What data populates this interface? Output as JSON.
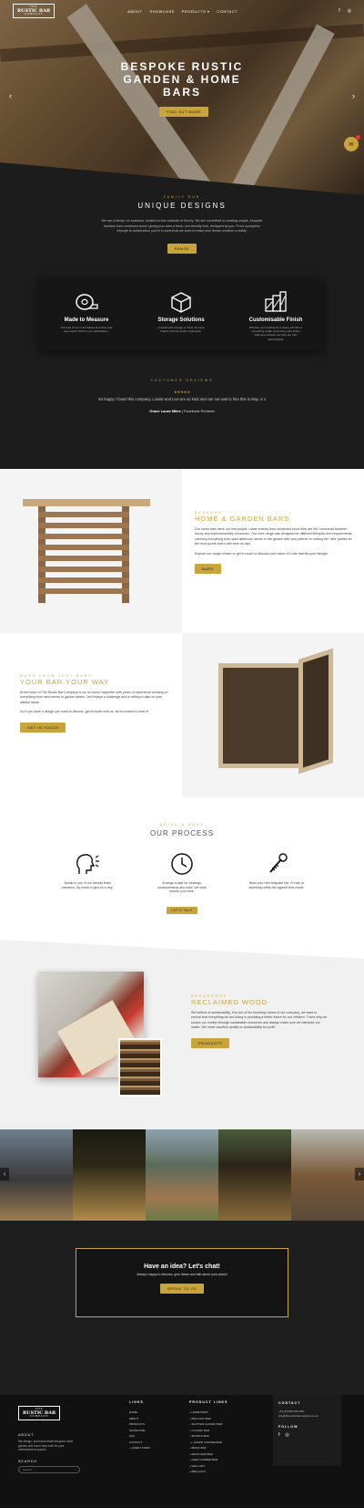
{
  "brand": {
    "logo_top": "THE",
    "logo_main": "RUSTIC BAR",
    "logo_sub": "COMPANY"
  },
  "nav": {
    "items": [
      "ABOUT",
      "SHOWCASE",
      "PRODUCTS ▾",
      "CONTACT"
    ],
    "social": [
      "f",
      "◎"
    ]
  },
  "hero": {
    "title_line1": "BESPOKE RUSTIC",
    "title_line2": "GARDEN & HOME",
    "title_line3": "BARS",
    "button": "FIND OUT MORE"
  },
  "intro": {
    "kicker": "FAMILY RUN",
    "title": "UNIQUE DESIGNS",
    "body": "We are a family run business, located on the outskirts of Surrey. We are committed to creating unique, bespoke furniture from reclaimed wood, giving your area a fresh, eco-friendly look, designed by you. From conception through to construction you're in control as we work to make your dream creation a reality.",
    "button": "RANGE"
  },
  "features": [
    {
      "icon": "tape-measure-icon",
      "title": "Made to Measure",
      "text": "Our bars come in all shapes and sizes and are custom built to your specification."
    },
    {
      "icon": "box-icon",
      "title": "Storage Solutions",
      "text": "Created with storage in mind, we have feature shelves and/or cupboards."
    },
    {
      "icon": "finish-icon",
      "title": "Customisable Finish",
      "text": "Whether your looking for a classy varnish or something a little more fancy with all the bells and whistles our bars are fully customisable."
    }
  ],
  "reviews": {
    "kicker": "CUSTOMER REVIEWS",
    "stars": "★★★★★",
    "quote": "So happy I found this company. Louise and Levi are so kind and can not wait to hire this in May. X x",
    "author": "Grace Laura Miles",
    "source": " | Facebook Reviews"
  },
  "home_bars": {
    "kicker": "BESPOKE",
    "title": "HOME & GARDEN BARS",
    "p1": "Our home bars were our first project, made entirely from reclaimed wood they are the 'crossroad between luxury and environmentally conscious'. Our core range was designed for different lifestyles and requirements, covering everything from quiet afternoon drinks in the garden with your partner to hosting the 'wild' parties for the next sports event with beer on tap!",
    "p2": "Explore our range of bars or get in touch to discuss your vision of a bar that fits your lifestyle.",
    "button": "BARS"
  },
  "your_way": {
    "kicker": "MADE FROM JUST BARS",
    "title": "YOUR BAR YOUR WAY",
    "p1": "At the heart of The Rustic Bar Company is our in-house carpenter with years of experience working on everything from new homes to garden tables. Levi enjoys a challenge and is willing to take on your wildest ideas.",
    "p2": "So if you have a design you want to discuss, get in touch with us, we're excited to hear it!",
    "button": "GET IN TOUCH"
  },
  "process": {
    "kicker": "QUICK & EASY",
    "title": "OUR PROCESS",
    "steps": [
      {
        "icon": "speaking-head-icon",
        "text": "Speak to one of our friendly team members. By email or give us a ring."
      },
      {
        "icon": "clock-icon",
        "text": "Arrange a date for viewings, measurements and build. We work around your time."
      },
      {
        "icon": "screw-icon",
        "text": "Build your new bespoke bar. On site or assembly within the agreed time frame."
      }
    ],
    "button": "LET'S TALK"
  },
  "reclaimed": {
    "kicker": "REPURPOSE",
    "title": "RECLAIMED WOOD",
    "body": "We believe in sustainability, it is one of the founding values of our company, we want to ensure that everything we are doing is providing a better future for our children. That's why we source our lumber through sustainable resources and always make sure we minimise our waste. We never sacrifice quality or sustainability for profit.",
    "button": "PRODUCTS"
  },
  "cta": {
    "title": "Have an idea? Let's chat!",
    "subtitle": "Always happy to discuss, give ideas and talk about your plans!",
    "button": "SPEAK TO US"
  },
  "footer": {
    "about_title": "ABOUT",
    "about_text": "We design, build and install bespoke rustic garden and home bars built for your entertainment spaces.",
    "search_title": "SEARCH",
    "search_placeholder": "Search ...",
    "links_title": "LINKS",
    "links": [
      "HOME",
      "ABOUT",
      "PRODUCTS",
      "SHOWCASE",
      "FAQ",
      "CONTACT",
      "» QUERY FORM"
    ],
    "product_links_title": "PRODUCT LINKS",
    "product_links": [
      "» HOME BARS",
      "– BALCONY BAR",
      "– SLATTED CLASSIC BAR",
      "– CLASSIC BAR",
      "– SPORTS BAR",
      "– L SHAPE CORNER BAR",
      "– BRICK BAR",
      "– BACKYARD BAR",
      "– KEEP CORNER BAR",
      "» WALL ART",
      "» BBQ HUTS"
    ],
    "contact_title": "CONTACT",
    "contact_phone": "+44 (0)7000 000 000",
    "contact_email": "info@therusticbarcompany.co.uk",
    "follow_title": "FOLLOW",
    "follow_icons": [
      "f",
      "◎"
    ]
  }
}
